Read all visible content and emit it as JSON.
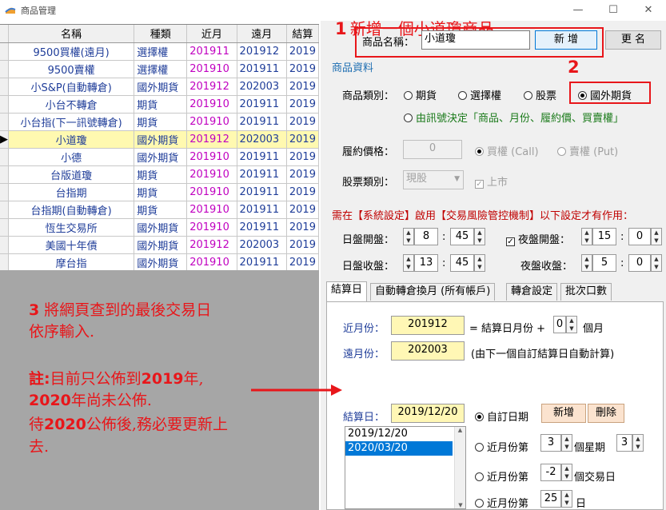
{
  "window": {
    "title": "商品管理",
    "minimize": "—",
    "maximize": "☐",
    "close": "✕"
  },
  "grid": {
    "columns": [
      "名稱",
      "種類",
      "近月",
      "遠月",
      "結算"
    ],
    "rows": [
      {
        "name": "9500買權(遠月)",
        "type": "選擇權",
        "near": "201911",
        "far": "201912",
        "sett": "2019"
      },
      {
        "name": "9500賣權",
        "type": "選擇權",
        "near": "201910",
        "far": "201911",
        "sett": "2019"
      },
      {
        "name": "小S&P(自動轉倉)",
        "type": "國外期貨",
        "near": "201912",
        "far": "202003",
        "sett": "2019"
      },
      {
        "name": "小台不轉倉",
        "type": "期貨",
        "near": "201910",
        "far": "201911",
        "sett": "2019"
      },
      {
        "name": "小台指(下一訊號轉倉)",
        "type": "期貨",
        "near": "201910",
        "far": "201911",
        "sett": "2019"
      },
      {
        "name": "小道瓊",
        "type": "國外期貨",
        "near": "201912",
        "far": "202003",
        "sett": "2019"
      },
      {
        "name": "小德",
        "type": "國外期貨",
        "near": "201910",
        "far": "201911",
        "sett": "2019"
      },
      {
        "name": "台版道瓊",
        "type": "期貨",
        "near": "201910",
        "far": "201911",
        "sett": "2019"
      },
      {
        "name": "台指期",
        "type": "期貨",
        "near": "201910",
        "far": "201911",
        "sett": "2019"
      },
      {
        "name": "台指期(自動轉倉)",
        "type": "期貨",
        "near": "201910",
        "far": "201911",
        "sett": "2019"
      },
      {
        "name": "恆生交易所",
        "type": "國外期貨",
        "near": "201910",
        "far": "201911",
        "sett": "2019"
      },
      {
        "name": "美國十年債",
        "type": "國外期貨",
        "near": "201912",
        "far": "202003",
        "sett": "2019"
      },
      {
        "name": "摩台指",
        "type": "國外期貨",
        "near": "201910",
        "far": "201911",
        "sett": "2019"
      }
    ],
    "active_row_marker": "▶"
  },
  "annotations": {
    "step1_num": "1",
    "step1_text": "新增一個小道瓊商品",
    "step2_num": "2",
    "step3_num": "3",
    "step3_line1": " 將網頁查到的最後交易日",
    "step3_line2": "依序輸入.",
    "note_a1": "註:",
    "note_a2": "目前只公佈到",
    "note_a3": "2019",
    "note_a4": "年,",
    "note_b1": "2020",
    "note_b2": "年尚未公佈.",
    "note_c1": "待",
    "note_c2": "2020",
    "note_c3": "公佈後,務必要更新上",
    "note_d": "去."
  },
  "form": {
    "name_label": "商品名稱：",
    "name_value": "小道瓊",
    "add_btn": "新 增",
    "rename_btn": "更 名",
    "section_title": "商品資料",
    "category_label": "商品類別：",
    "cat_options": [
      "期貨",
      "選擇權",
      "股票",
      "國外期貨"
    ],
    "cat_signal": "由訊號決定「商品、月份、履約價、買賣權」",
    "strike_label": "履約價格：",
    "strike_value": "0",
    "call_label": "買權 (Call)",
    "put_label": "賣權 (Put)",
    "stock_type_label": "股票類別：",
    "stock_type_value": "現股",
    "listed_label": "上市",
    "risk_note": "需在【系統設定】啟用【交易風險管控機制】以下設定才有作用：",
    "day_open_label": "日盤開盤：",
    "day_open_h": "8",
    "day_open_m": "45",
    "night_open_label": "夜盤開盤：",
    "night_open_h": "15",
    "night_open_m": "0",
    "day_close_label": "日盤收盤：",
    "day_close_h": "13",
    "day_close_m": "45",
    "night_close_label": "夜盤收盤：",
    "night_close_h": "5",
    "night_close_m": "0"
  },
  "tabs": [
    "結算日",
    "自動轉倉換月 (所有帳戶)",
    "轉倉設定",
    "批次口數"
  ],
  "settle": {
    "near_label": "近月份：",
    "near_value": "201912",
    "near_formula": "= 結算日月份 +",
    "near_offset": "0",
    "near_unit": "個月",
    "far_label": "遠月份：",
    "far_value": "202003",
    "far_note": "(由下一個自訂結算日自動計算)",
    "date_label": "結算日：",
    "date_value": "2019/12/20",
    "custom_label": "自訂日期",
    "add_btn": "新增",
    "del_btn": "刪除",
    "dates": [
      "2019/12/20",
      "2020/03/20"
    ],
    "opt1_a": "近月份第",
    "opt1_n": "3",
    "opt1_b": "個星期",
    "opt1_w": "3",
    "opt2_a": "近月份第",
    "opt2_n": "-2",
    "opt2_b": "個交易日",
    "opt3_a": "近月份第",
    "opt3_n": "25",
    "opt3_b": "日"
  },
  "colors": {
    "annotation_red": "#e8161a",
    "near_month_magenta": "#c000c0",
    "grid_text_blue": "#1f3d99",
    "active_row_yellow": "#fff9b0",
    "highlight_yellow": "#fff7b5"
  }
}
